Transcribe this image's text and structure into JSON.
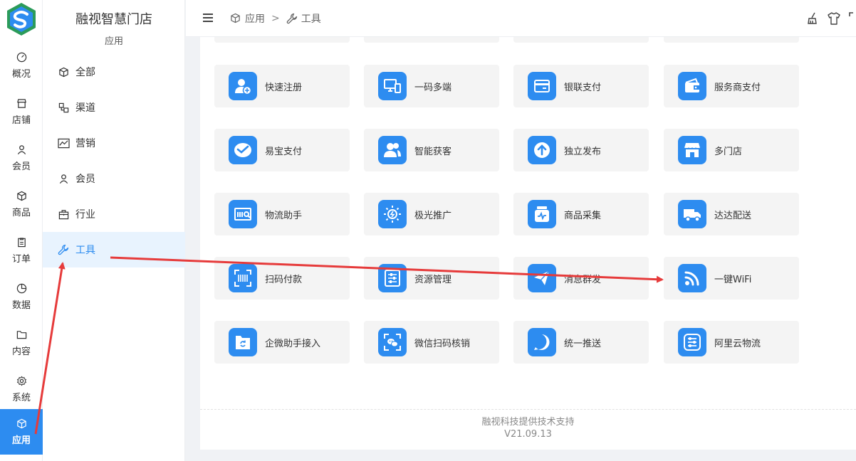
{
  "brand": {
    "name": "融视智慧门店"
  },
  "rail": {
    "items": [
      {
        "label": "概况",
        "icon": "dashboard-icon"
      },
      {
        "label": "店铺",
        "icon": "store-icon"
      },
      {
        "label": "会员",
        "icon": "user-icon"
      },
      {
        "label": "商品",
        "icon": "cube-icon"
      },
      {
        "label": "订单",
        "icon": "clipboard-icon"
      },
      {
        "label": "数据",
        "icon": "pie-chart-icon"
      },
      {
        "label": "内容",
        "icon": "folder-icon"
      },
      {
        "label": "系统",
        "icon": "gear-icon"
      },
      {
        "label": "应用",
        "icon": "cube-icon",
        "active": true
      }
    ]
  },
  "sidebar": {
    "title": "应用",
    "items": [
      {
        "label": "全部",
        "icon": "cube-icon"
      },
      {
        "label": "渠道",
        "icon": "channel-icon"
      },
      {
        "label": "营销",
        "icon": "chart-line-icon"
      },
      {
        "label": "会员",
        "icon": "user-icon"
      },
      {
        "label": "行业",
        "icon": "briefcase-icon"
      },
      {
        "label": "工具",
        "icon": "wrench-icon",
        "active": true
      }
    ]
  },
  "header": {
    "breadcrumb": [
      "应用",
      "工具"
    ],
    "separator": ">",
    "icons": [
      "broom-icon",
      "tshirt-icon",
      "fullscreen-icon"
    ]
  },
  "tools": [
    {
      "label": "快速注册",
      "icon": "user-add-icon"
    },
    {
      "label": "一码多端",
      "icon": "multi-device-icon"
    },
    {
      "label": "银联支付",
      "icon": "card-icon"
    },
    {
      "label": "服务商支付",
      "icon": "wallet-icon"
    },
    {
      "label": "易宝支付",
      "icon": "pay-check-icon"
    },
    {
      "label": "智能获客",
      "icon": "users-icon"
    },
    {
      "label": "独立发布",
      "icon": "upload-icon"
    },
    {
      "label": "多门店",
      "icon": "shop-icon"
    },
    {
      "label": "物流助手",
      "icon": "logistics-icon"
    },
    {
      "label": "极光推广",
      "icon": "sun-icon"
    },
    {
      "label": "商品采集",
      "icon": "collect-icon"
    },
    {
      "label": "达达配送",
      "icon": "truck-icon"
    },
    {
      "label": "扫码付款",
      "icon": "barcode-icon"
    },
    {
      "label": "资源管理",
      "icon": "sliders-icon"
    },
    {
      "label": "消息群发",
      "icon": "send-icon"
    },
    {
      "label": "一键WiFi",
      "icon": "wifi-icon"
    },
    {
      "label": "企微助手接入",
      "icon": "folder-sync-icon"
    },
    {
      "label": "微信扫码核销",
      "icon": "wechat-scan-icon"
    },
    {
      "label": "统一推送",
      "icon": "push-arrow-icon"
    },
    {
      "label": "阿里云物流",
      "icon": "route-icon"
    }
  ],
  "footer": {
    "support": "融视科技提供技术支持",
    "version": "V21.09.13"
  },
  "colors": {
    "accent": "#2d8cf0",
    "annotation": "#e63b3b",
    "tile_bg": "#f4f4f4"
  }
}
